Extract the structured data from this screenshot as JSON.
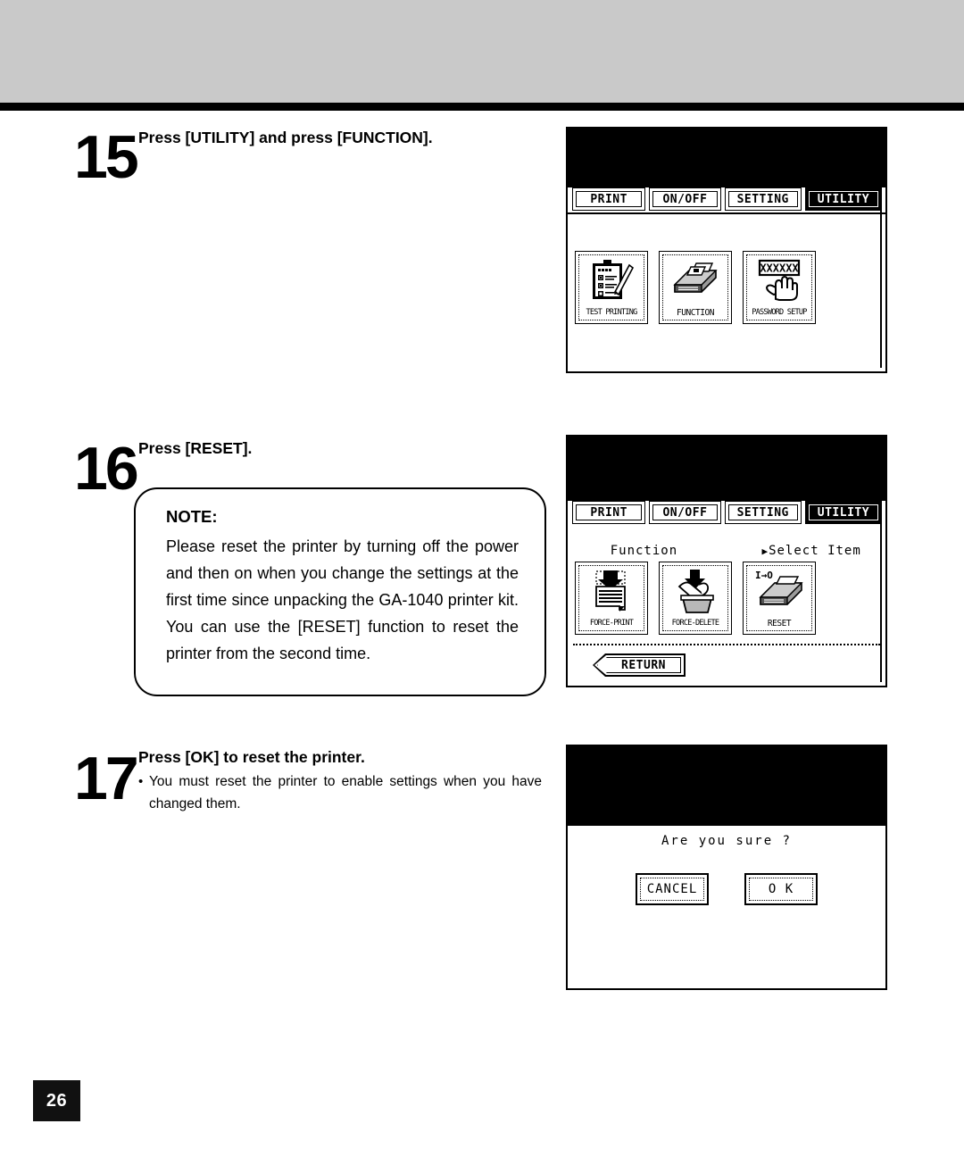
{
  "page": {
    "number": "26"
  },
  "steps": [
    {
      "number": "15",
      "title": "Press [UTILITY] and press [FUNCTION]."
    },
    {
      "number": "16",
      "title": "Press [RESET].",
      "note": {
        "label": "NOTE:",
        "body": "Please reset the printer by turning off the power and then on when you change the settings at the first time since unpacking the GA-1040 printer kit.  You can use the [RESET] function to reset the printer from the second time."
      }
    },
    {
      "number": "17",
      "title": "Press [OK] to reset the printer.",
      "bullet": {
        "dot": "•",
        "text": "You must reset the printer to enable settings when you have changed them."
      }
    }
  ],
  "panels": [
    {
      "id": "utility-menu",
      "tabs": [
        {
          "label": "PRINT",
          "selected": false
        },
        {
          "label": "ON/OFF",
          "selected": false
        },
        {
          "label": "SETTING",
          "selected": false
        },
        {
          "label": "UTILITY",
          "selected": true
        }
      ],
      "buttons": [
        {
          "label": "TEST PRINTING",
          "icon": "clipboard-checklist-pencil-icon"
        },
        {
          "label": "FUNCTION",
          "icon": "printer-icon"
        },
        {
          "label": "PASSWORD SETUP",
          "icon": "password-hand-icon",
          "badge": "XXXXXX"
        }
      ]
    },
    {
      "id": "function-menu",
      "tabs": [
        {
          "label": "PRINT",
          "selected": false
        },
        {
          "label": "ON/OFF",
          "selected": false
        },
        {
          "label": "SETTING",
          "selected": false
        },
        {
          "label": "UTILITY",
          "selected": true
        }
      ],
      "status": {
        "left": "Function",
        "pointer": "▶",
        "right": "Select Item"
      },
      "buttons": [
        {
          "label": "FORCE-PRINT",
          "icon": "document-down-arrow-icon"
        },
        {
          "label": "FORCE-DELETE",
          "icon": "trash-hand-icon"
        },
        {
          "label": "RESET",
          "icon": "printer-reset-icon",
          "badge": "I→O"
        }
      ],
      "return_label": "RETURN"
    },
    {
      "id": "confirm-dialog",
      "message": "Are you sure ?",
      "buttons": [
        {
          "label": "CANCEL"
        },
        {
          "label": "O K"
        }
      ]
    }
  ],
  "colors": {
    "band": "#c9c9c9",
    "ink": "#000000",
    "paper": "#ffffff"
  }
}
